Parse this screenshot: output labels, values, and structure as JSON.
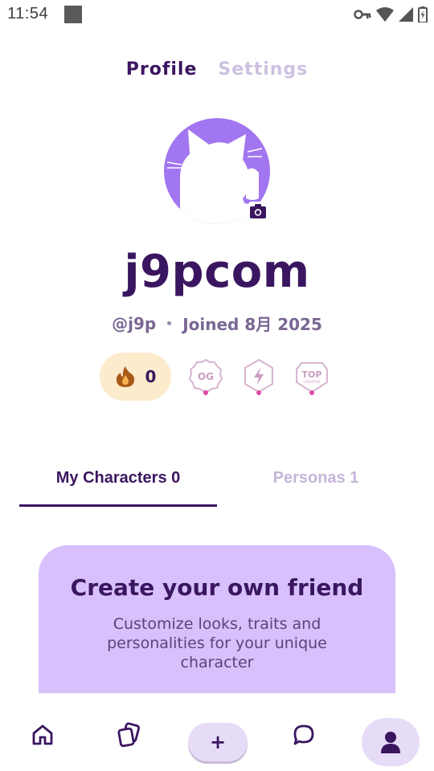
{
  "status_bar": {
    "time": "11:54"
  },
  "top_tabs": {
    "profile": "Profile",
    "settings": "Settings"
  },
  "profile": {
    "display_name": "j9pcom",
    "handle": "@j9p",
    "joined": "Joined 8月 2025",
    "streak_count": "0"
  },
  "badges": {
    "og": "OG",
    "top": "TOP",
    "top_sub": "CREATOR"
  },
  "section_tabs": {
    "characters": "My Characters 0",
    "personas": "Personas 1"
  },
  "create_card": {
    "title": "Create your own friend",
    "description": "Customize looks, traits and personalities for your unique character"
  },
  "bottom_nav": {
    "add_label": "+"
  },
  "colors": {
    "accent": "#3b1660",
    "avatar_bg": "#a276f0",
    "card_bg": "#d7c0fb",
    "streak_bg": "#fdebcd"
  }
}
